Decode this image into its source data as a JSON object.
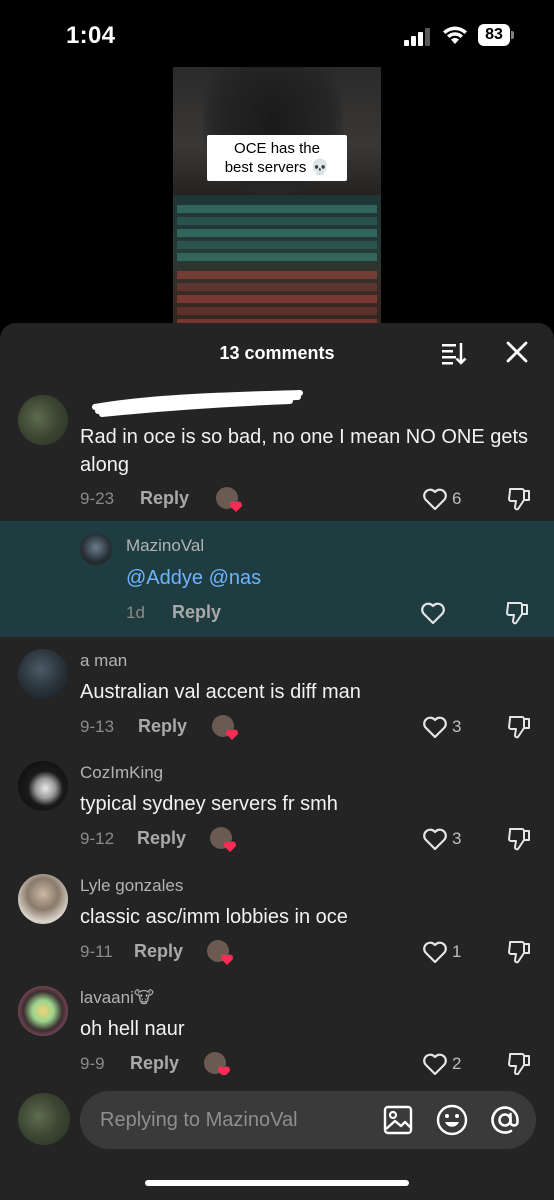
{
  "status_bar": {
    "time": "1:04",
    "battery": "83"
  },
  "video": {
    "caption_line1": "OCE has the",
    "caption_line2": "best servers 💀"
  },
  "sheet": {
    "title": "13 comments"
  },
  "comments": [
    {
      "username": "",
      "text": "Rad in oce is so bad, no one I mean NO ONE gets along",
      "date": "9-23",
      "reply": "Reply",
      "likes": "6"
    },
    {
      "username": "MazinoVal",
      "mention": "@Addye @nas",
      "date": "1d",
      "reply": "Reply",
      "likes": ""
    },
    {
      "username": "a man",
      "text": "Australian val accent is diff man",
      "date": "9-13",
      "reply": "Reply",
      "likes": "3"
    },
    {
      "username": "CozImKing",
      "text": "typical sydney servers fr smh",
      "date": "9-12",
      "reply": "Reply",
      "likes": "3"
    },
    {
      "username": "Lyle gonzales",
      "text": "classic asc/imm lobbies in oce",
      "date": "9-11",
      "reply": "Reply",
      "likes": "1"
    },
    {
      "username": "lavaani🐮",
      "text": "oh hell naur",
      "date": "9-9",
      "reply": "Reply",
      "likes": "2"
    }
  ],
  "input": {
    "placeholder": "Replying to MazinoVal"
  },
  "colors": {
    "sheet_bg": "#242424",
    "highlight_bg": "#1f3c41",
    "mention": "#6eb4ff",
    "heart_red": "#fe2c55"
  }
}
